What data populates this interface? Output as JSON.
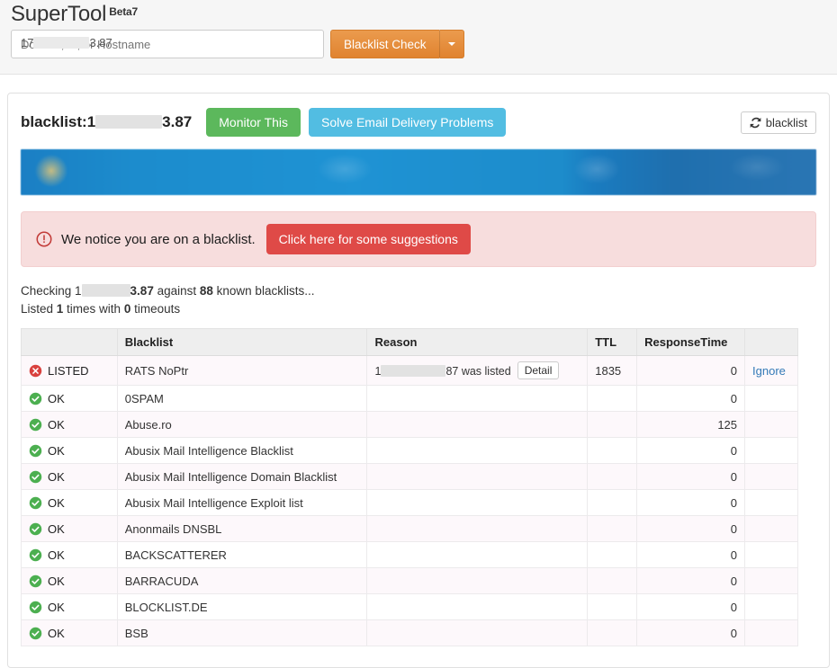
{
  "app": {
    "brand": "SuperTool",
    "beta_label": "Beta7"
  },
  "search": {
    "value_prefix": "17",
    "value_suffix": "3.87",
    "placeholder": "Domain, IP, or Hostname",
    "submit_label": "Blacklist Check",
    "dropdown_icon": "chevron-down-icon"
  },
  "panel": {
    "title_prefix": "blacklist:1",
    "title_suffix": "3.87",
    "monitor_label": "Monitor This",
    "solve_label": "Solve Email Delivery Problems",
    "refresh_label": "blacklist",
    "refresh_icon": "refresh-icon"
  },
  "alert": {
    "icon": "alert-circle-icon",
    "message": "We notice you are on a blacklist.",
    "button_label": "Click here for some suggestions",
    "bg_color": "#f7dddd",
    "button_color": "#df4a47"
  },
  "status": {
    "checking_prefix": "Checking 1",
    "checking_suffix": "3.87",
    "against_text": " against ",
    "blacklist_count": "88",
    "known_text": " known blacklists...",
    "listed_prefix": "Listed ",
    "listed_count": "1",
    "listed_mid": " times with ",
    "timeout_count": "0",
    "listed_suffix": " timeouts"
  },
  "table": {
    "headers": [
      "",
      "Blacklist",
      "Reason",
      "TTL",
      "ResponseTime",
      ""
    ],
    "rows": [
      {
        "status": "LISTED",
        "status_icon": "error-circle-icon",
        "blacklist": "RATS NoPtr",
        "reason_prefix": "1",
        "reason_suffix": "87 was listed",
        "detail_label": "Detail",
        "ttl": "1835",
        "response_time": "0",
        "action": "Ignore"
      },
      {
        "status": "OK",
        "status_icon": "check-circle-icon",
        "blacklist": "0SPAM",
        "reason_prefix": "",
        "reason_suffix": "",
        "detail_label": "",
        "ttl": "",
        "response_time": "0",
        "action": ""
      },
      {
        "status": "OK",
        "status_icon": "check-circle-icon",
        "blacklist": "Abuse.ro",
        "reason_prefix": "",
        "reason_suffix": "",
        "detail_label": "",
        "ttl": "",
        "response_time": "125",
        "action": ""
      },
      {
        "status": "OK",
        "status_icon": "check-circle-icon",
        "blacklist": "Abusix Mail Intelligence Blacklist",
        "reason_prefix": "",
        "reason_suffix": "",
        "detail_label": "",
        "ttl": "",
        "response_time": "0",
        "action": ""
      },
      {
        "status": "OK",
        "status_icon": "check-circle-icon",
        "blacklist": "Abusix Mail Intelligence Domain Blacklist",
        "reason_prefix": "",
        "reason_suffix": "",
        "detail_label": "",
        "ttl": "",
        "response_time": "0",
        "action": ""
      },
      {
        "status": "OK",
        "status_icon": "check-circle-icon",
        "blacklist": "Abusix Mail Intelligence Exploit list",
        "reason_prefix": "",
        "reason_suffix": "",
        "detail_label": "",
        "ttl": "",
        "response_time": "0",
        "action": ""
      },
      {
        "status": "OK",
        "status_icon": "check-circle-icon",
        "blacklist": "Anonmails DNSBL",
        "reason_prefix": "",
        "reason_suffix": "",
        "detail_label": "",
        "ttl": "",
        "response_time": "0",
        "action": ""
      },
      {
        "status": "OK",
        "status_icon": "check-circle-icon",
        "blacklist": "BACKSCATTERER",
        "reason_prefix": "",
        "reason_suffix": "",
        "detail_label": "",
        "ttl": "",
        "response_time": "0",
        "action": ""
      },
      {
        "status": "OK",
        "status_icon": "check-circle-icon",
        "blacklist": "BARRACUDA",
        "reason_prefix": "",
        "reason_suffix": "",
        "detail_label": "",
        "ttl": "",
        "response_time": "0",
        "action": ""
      },
      {
        "status": "OK",
        "status_icon": "check-circle-icon",
        "blacklist": "BLOCKLIST.DE",
        "reason_prefix": "",
        "reason_suffix": "",
        "detail_label": "",
        "ttl": "",
        "response_time": "0",
        "action": ""
      },
      {
        "status": "OK",
        "status_icon": "check-circle-icon",
        "blacklist": "BSB",
        "reason_prefix": "",
        "reason_suffix": "",
        "detail_label": "",
        "ttl": "",
        "response_time": "0",
        "action": ""
      }
    ]
  },
  "colors": {
    "orange": "#e0832f",
    "green": "#5cb85c",
    "blue": "#52bde2",
    "red": "#df4a47",
    "link": "#337ab7"
  }
}
